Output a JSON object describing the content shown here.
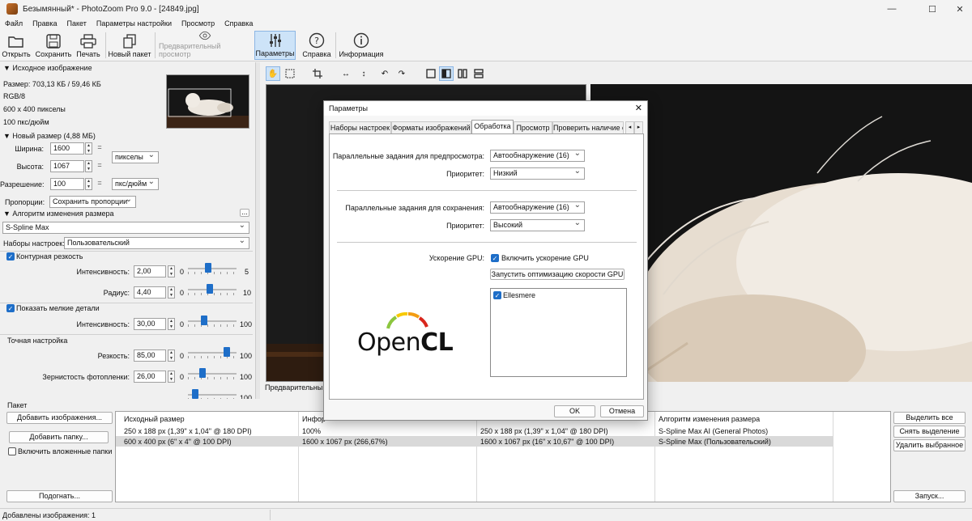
{
  "window": {
    "title": "Безымянный* - PhotoZoom Pro 9.0 - [24849.jpg]",
    "minimize": "—",
    "maximize": "☐",
    "close": "✕"
  },
  "menu": [
    "Файл",
    "Правка",
    "Пакет",
    "Параметры настройки",
    "Просмотр",
    "Справка"
  ],
  "toolbar": {
    "open": "Открыть",
    "save": "Сохранить",
    "print": "Печать",
    "new_batch": "Новый пакет",
    "preview": "Предварительный просмотр",
    "params": "Параметры",
    "help": "Справка",
    "info": "Информация"
  },
  "source": {
    "header": "Исходное изображение",
    "size": "Размер: 703,13 КБ / 59,46 КБ",
    "mode": "RGB/8",
    "pixels": "600 x 400 пикселы",
    "resolution": "100 пкс/дюйм"
  },
  "new_size": {
    "header": "Новый размер (4,88 МБ)",
    "width_label": "Ширина:",
    "width": "1600",
    "height_label": "Высота:",
    "height": "1067",
    "unit": "пикселы",
    "res_label": "Разрешение:",
    "res": "100",
    "res_unit": "пкс/дюйм",
    "prop_label": "Пропорции:",
    "prop": "Сохранить пропорции",
    "link": "="
  },
  "algo": {
    "header": "Алгоритм изменения размера",
    "more": "...",
    "method": "S-Spline Max",
    "preset_label": "Наборы настроек:",
    "preset": "Пользовательский",
    "contour": "Контурная резкость",
    "intensity_label": "Интенсивность:",
    "intensity": "2,00",
    "intensity_min": "0",
    "intensity_max": "5",
    "intensity_frac": 0.4,
    "radius_label": "Радиус:",
    "radius": "4,40",
    "radius_min": "0",
    "radius_max": "10",
    "radius_frac": 0.44,
    "details": "Показать мелкие детали",
    "det_intensity_label": "Интенсивность:",
    "det_intensity": "30,00",
    "det_min": "0",
    "det_max": "100",
    "det_frac": 0.3,
    "fine": "Точная настройка",
    "sharp_label": "Резкость:",
    "sharp": "85,00",
    "sharp_min": "0",
    "sharp_max": "100",
    "sharp_frac": 0.85,
    "grain_label": "Зернистость фотопленки:",
    "grain": "26,00",
    "grain_min": "0",
    "grain_max": "100",
    "grain_frac": 0.26,
    "extra_max": "100",
    "extra_frac": 0.1
  },
  "view": {
    "preview_label": "Предварительный"
  },
  "dialog": {
    "title": "Параметры",
    "close": "✕",
    "tabs": [
      "Наборы настроек",
      "Форматы изображений",
      "Обработка",
      "Просмотр",
      "Проверить наличие о"
    ],
    "active_tab": "Обработка",
    "par_preview_label": "Параллельные задания для предпросмотра:",
    "par_preview": "Автообнаружение (16)",
    "prio1_label": "Приоритет:",
    "prio1": "Низкий",
    "par_save_label": "Параллельные задания для сохранения:",
    "par_save": "Автообнаружение (16)",
    "prio2_label": "Приоритет:",
    "prio2": "Высокий",
    "gpu_label": "Ускорение GPU:",
    "gpu_enable": "Включить ускорение GPU",
    "gpu_opt": "Запустить оптимизацию скорости GPU",
    "gpu_device": "Ellesmere",
    "opencl_a": "Open",
    "opencl_b": "CL",
    "ok": "OK",
    "cancel": "Отмена"
  },
  "batch": {
    "header": "Пакет",
    "add_images": "Добавить изображения...",
    "add_folder": "Добавить папку...",
    "include_sub": "Включить вложенные папки",
    "fit": "Подогнать...",
    "select_all": "Выделить все",
    "deselect": "Снять выделение",
    "remove_sel": "Удалить выбранное",
    "run": "Запуск...",
    "columns": [
      "Исходный размер",
      "Инфор",
      "",
      "Алгоритм изменения размера"
    ],
    "rows": [
      [
        "250 x 188 px (1,39\" x 1,04\" @ 180 DPI)",
        "100%",
        "250 x 188 px (1,39\" x 1,04\" @ 180 DPI)",
        "S-Spline Max AI (General Photos)"
      ],
      [
        "600 x 400 px (6\" x 4\" @ 100 DPI)",
        "1600 x 1067 px (266,67%)",
        "1600 x 1067 px (16\" x 10,67\" @ 100 DPI)",
        "S-Spline Max (Пользовательский)"
      ]
    ]
  },
  "status": {
    "text": "Добавлены изображения: 1"
  }
}
